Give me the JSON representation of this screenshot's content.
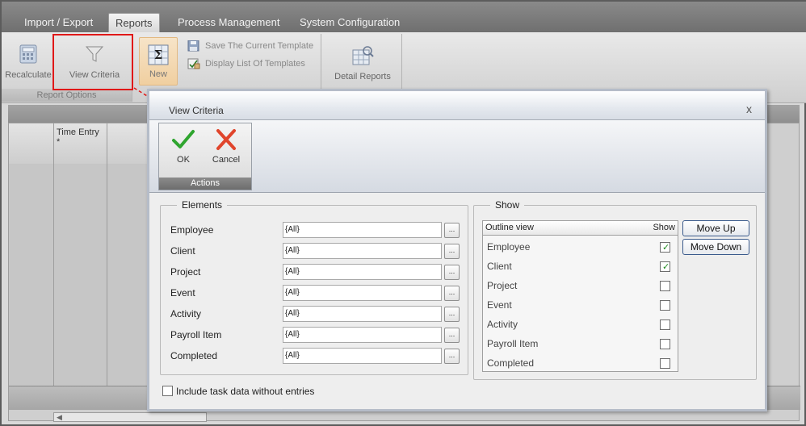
{
  "tabs": [
    {
      "label": "Import / Export",
      "active": false
    },
    {
      "label": "Reports",
      "active": true
    },
    {
      "label": "Process Management",
      "active": false
    },
    {
      "label": "System Configuration",
      "active": false
    }
  ],
  "ribbon": {
    "recalculate_label": "Recalculate",
    "view_criteria_label": "View Criteria",
    "report_options_label": "Report Options",
    "new_label": "New",
    "save_template_label": "Save The Current Template",
    "display_templates_label": "Display List Of Templates",
    "detail_reports_label": "Detail Reports"
  },
  "background_grid": {
    "column_header": "Time Entry *"
  },
  "dialog": {
    "title": "View Criteria",
    "close_glyph": "x",
    "ok_label": "OK",
    "cancel_label": "Cancel",
    "actions_label": "Actions",
    "elements_legend": "Elements",
    "show_legend": "Show",
    "elements": [
      {
        "name": "Employee",
        "value": "{All}"
      },
      {
        "name": "Client",
        "value": "{All}"
      },
      {
        "name": "Project",
        "value": "{All}"
      },
      {
        "name": "Event",
        "value": "{All}"
      },
      {
        "name": "Activity",
        "value": "{All}"
      },
      {
        "name": "Payroll Item",
        "value": "{All}"
      },
      {
        "name": "Completed",
        "value": "{All}"
      }
    ],
    "dots_label": "...",
    "outline_header": "Outline view",
    "show_header": "Show",
    "outline_items": [
      {
        "name": "Employee",
        "checked": true
      },
      {
        "name": "Client",
        "checked": true
      },
      {
        "name": "Project",
        "checked": false
      },
      {
        "name": "Event",
        "checked": false
      },
      {
        "name": "Activity",
        "checked": false
      },
      {
        "name": "Payroll Item",
        "checked": false
      },
      {
        "name": "Completed",
        "checked": false
      }
    ],
    "move_up_label": "Move Up",
    "move_down_label": "Move Down",
    "include_label": "Include task data without entries"
  },
  "colors": {
    "highlight": "#e01818",
    "check": "#1f8a1f"
  }
}
